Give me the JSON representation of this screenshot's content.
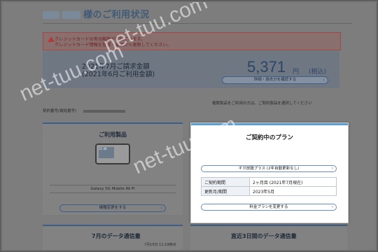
{
  "header": {
    "title_suffix": "様のご利用状況"
  },
  "alert": {
    "line1": "クレジットカードの有効期限が切れています。",
    "line2": "クレジットカード情報を登録・変更から更新してください。"
  },
  "billing": {
    "month_line1": "2021年7月ご請求金額",
    "month_line2": "(2021年6月ご利用金額)",
    "amount": "5,371",
    "yen": "円",
    "tax": "(税込)",
    "detail_button": "詳細・過去分を確認する"
  },
  "contract": {
    "number_label": "契約番号(電話番号)",
    "select_note": "複数製品をご利用の方は、ご契約製品を選択してください"
  },
  "product_card": {
    "title": "ご利用製品",
    "screen_time": "11:48",
    "name": "Galaxy 5G Mobile Wi-Fi",
    "change_button": "機種変更をする"
  },
  "plan_card": {
    "title": "ご契約中のプラン",
    "plan_name": "ギガ放題プラス (2年自動更新なし)",
    "rows": [
      {
        "label": "ご契約期間",
        "value": "2ヶ月目 (2021年7月現在)"
      },
      {
        "label": "更新月/期間",
        "value": "2023年5月"
      }
    ],
    "change_plan_button": "料金プランを変更する"
  },
  "bottom": {
    "left_title": "7月のデータ通信量",
    "left_timestamp": "7月15日 11:19時点",
    "right_title": "直近3日間のデータ通信量"
  },
  "watermarks": [
    "net-tuu.com",
    "net-tuu.com",
    "net-tuu.com"
  ],
  "colors": {
    "accent": "#3b5f88",
    "plan_top": "#5aa0d4",
    "alert": "#b43a3a"
  }
}
